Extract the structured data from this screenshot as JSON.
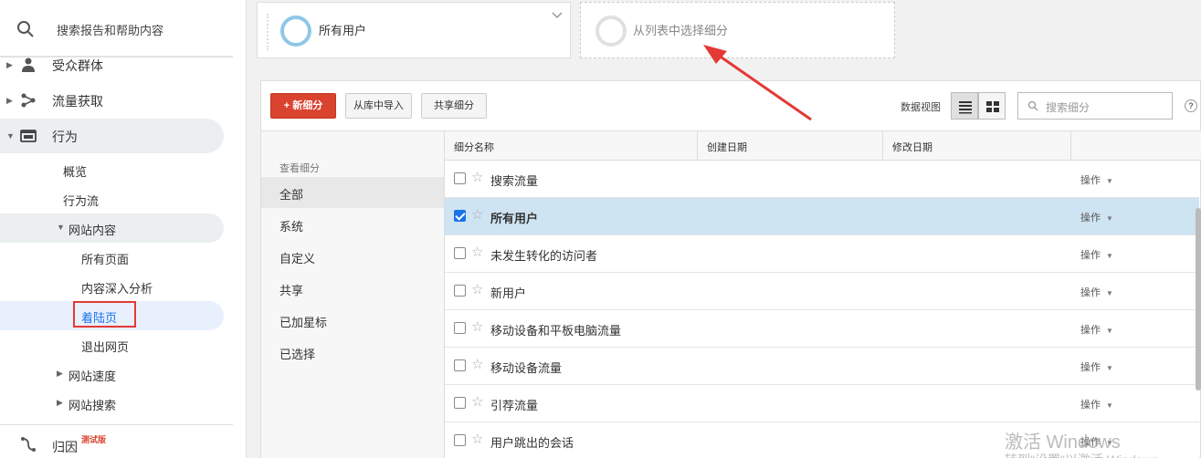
{
  "sidebar": {
    "search_text": "搜索报告和帮助内容",
    "nav": [
      {
        "label": "受众群体"
      },
      {
        "label": "流量获取"
      },
      {
        "label": "行为"
      }
    ],
    "behavior_sub": [
      "概览",
      "行为流"
    ],
    "site_content": "网站内容",
    "site_content_sub": [
      "所有页面",
      "内容深入分析",
      "着陆页",
      "退出网页"
    ],
    "site_speed": "网站速度",
    "site_search": "网站搜索",
    "attribution": "归因",
    "attribution_badge": "测试版"
  },
  "segments": {
    "card1": "所有用户",
    "card2": "从列表中选择细分"
  },
  "toolbar": {
    "new_segment": "+ 新细分",
    "import": "从库中导入",
    "share": "共享细分",
    "view_label": "数据视图",
    "search_placeholder": "搜索细分",
    "help": "?"
  },
  "filter_list": {
    "header": "查看细分",
    "items": [
      "全部",
      "系统",
      "自定义",
      "共享",
      "已加星标",
      "已选择"
    ]
  },
  "table": {
    "headers": [
      "细分名称",
      "创建日期",
      "修改日期"
    ],
    "action_label": "操作",
    "rows": [
      {
        "name": "搜索流量",
        "checked": false
      },
      {
        "name": "所有用户",
        "checked": true
      },
      {
        "name": "未发生转化的访问者",
        "checked": false
      },
      {
        "name": "新用户",
        "checked": false
      },
      {
        "name": "移动设备和平板电脑流量",
        "checked": false
      },
      {
        "name": "移动设备流量",
        "checked": false
      },
      {
        "name": "引荐流量",
        "checked": false
      },
      {
        "name": "用户跳出的会话",
        "checked": false
      }
    ]
  },
  "watermark": {
    "line1": "激活 Windows",
    "line2": "转到\"设置\"以激活 Windows。"
  },
  "colors": {
    "primary_red": "#d9432f",
    "selected_row": "#cfe4f3",
    "annotation_red": "#e53935"
  }
}
